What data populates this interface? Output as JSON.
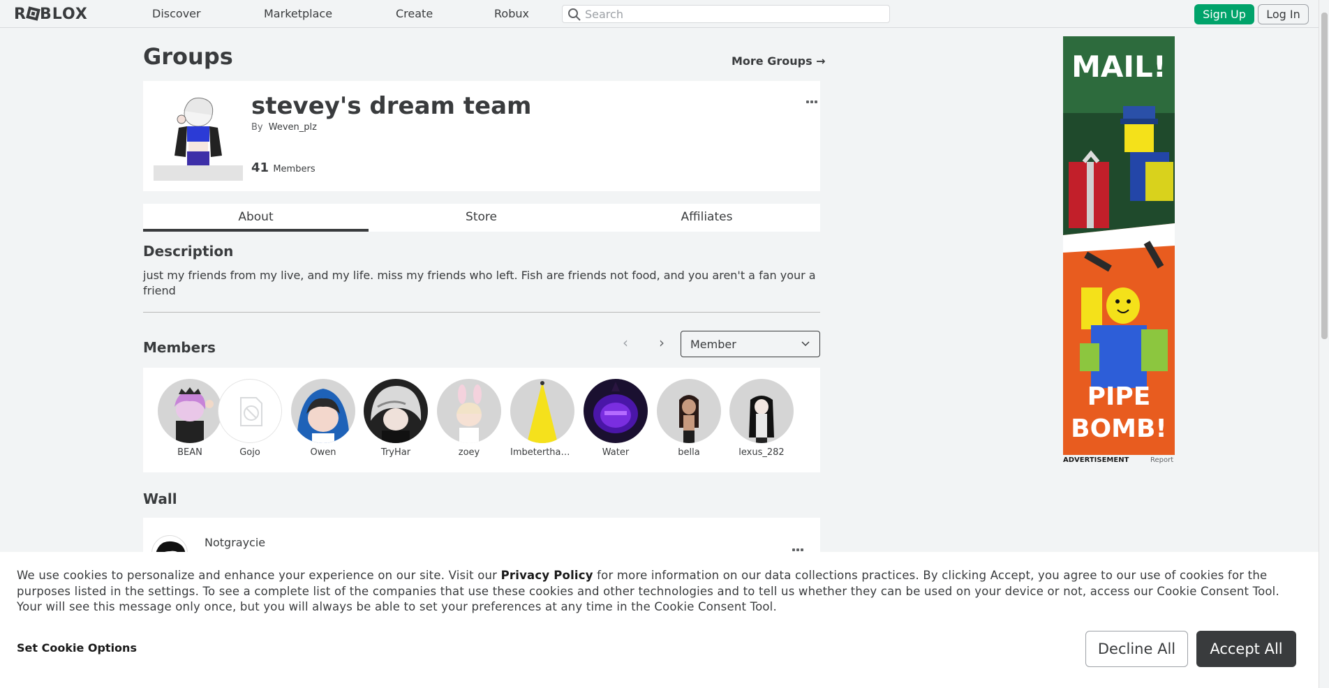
{
  "header": {
    "logo_text": "ROBLOX",
    "nav": [
      "Discover",
      "Marketplace",
      "Create",
      "Robux"
    ],
    "search_placeholder": "Search",
    "signup_label": "Sign Up",
    "login_label": "Log In"
  },
  "page": {
    "title": "Groups",
    "more_groups": "More Groups →"
  },
  "group": {
    "name": "stevey's dream team",
    "by_label": "By",
    "owner": "Weven_plz",
    "member_count": "41",
    "members_label": "Members"
  },
  "tabs": [
    "About",
    "Store",
    "Affiliates"
  ],
  "description": {
    "title": "Description",
    "text": "just my friends from my live, and my life. miss my friends who left. Fish are friends not food, and you aren't a fan your a friend"
  },
  "members_section": {
    "title": "Members",
    "role_selected": "Member",
    "members": [
      {
        "name": "BEAN"
      },
      {
        "name": "Gojo"
      },
      {
        "name": "Owen"
      },
      {
        "name": "TryHar"
      },
      {
        "name": "zoey"
      },
      {
        "name": "Imbeterthan..."
      },
      {
        "name": "Water"
      },
      {
        "name": "bella"
      },
      {
        "name": "lexus_282"
      }
    ]
  },
  "wall": {
    "title": "Wall",
    "first_post_author": "Notgraycie"
  },
  "ad": {
    "headline_top": "MAIL!",
    "headline_bottom_1": "PIPE",
    "headline_bottom_2": "BOMB!",
    "label": "ADVERTISEMENT",
    "report": "Report"
  },
  "cookie": {
    "text_before": "We use cookies to personalize and enhance your experience on our site. Visit our ",
    "privacy_link": "Privacy Policy",
    "text_after": " for more information on our data collections practices. By clicking Accept, you agree to our use of cookies for the purposes listed in the settings. To see a complete list of the companies that use these cookies and other technologies and to tell us whether they can be used on your device or not, access our Cookie Consent Tool. Your will see this message only once, but you will always be able to set your preferences at any time in the Cookie Consent Tool.",
    "set_options": "Set Cookie Options",
    "decline": "Decline All",
    "accept": "Accept All"
  }
}
